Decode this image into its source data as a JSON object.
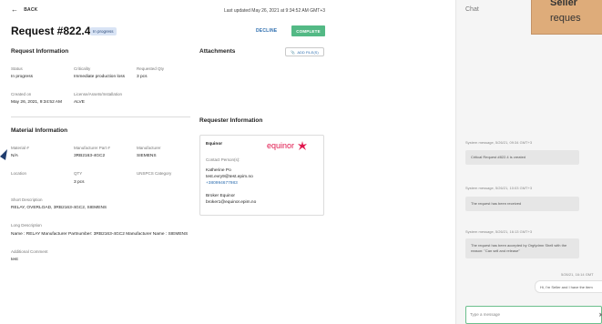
{
  "header": {
    "back_label": "BACK",
    "last_updated": "Last updated May 26, 2021 at 9:34:52 AM GMT+3",
    "title": "Request #822.4",
    "status": "In progress",
    "decline_label": "DECLINE",
    "complete_label": "COMPLETE"
  },
  "request_info": {
    "section_title": "Request Information",
    "status_label": "Status",
    "status_value": "In progress",
    "criticality_label": "Criticality",
    "criticality_value": "Immediate production loss",
    "requested_qty_label": "Requested Qty",
    "requested_qty_value": "3 pcs",
    "created_on_label": "Created on",
    "created_on_value": "May 26, 2021, 9:34:52 AM",
    "license_label": "License/Assets/Installation",
    "license_value": "ALVE"
  },
  "material_info": {
    "section_title": "Material Information",
    "material_no_label": "Material #",
    "material_no_value": "N/A",
    "mfr_part_label": "Manufacturer Part #",
    "mfr_part_value": "3RB2163-4GC2",
    "manufacturer_label": "Manufacturer",
    "manufacturer_value": "SIEMENS",
    "location_label": "Location",
    "qty_label": "QTY",
    "qty_value": "3 pcs",
    "unspsc_label": "UNSPCS Category",
    "short_desc_label": "Short Description",
    "short_desc_value": "RELAY, OVERLOAD, 3RB2163-4GC2, SIEMENS",
    "long_desc_label": "Long Description",
    "long_desc_value": "Name : RELAY Manufacturer Partnumber: 3RB2163-4GC2 Manufacturer Name : SIEMENS",
    "additional_comment_label": "Additional Comment",
    "additional_comment_value": "test"
  },
  "attachments": {
    "section_title": "Attachments",
    "add_files_label": "ADD FILE(S)"
  },
  "requester": {
    "section_title": "Requester Information",
    "company": "Equinor",
    "logo_text": "equinor",
    "contact_label": "Contact Person(s):",
    "contact_name": "Katherine Po",
    "contact_email": "test.evry9@test.epim.no",
    "contact_phone": "+380994677983",
    "broker_label": "Broker Equinor",
    "broker_email": "broker1@equinor.epim.no"
  },
  "chat": {
    "title": "Chat",
    "overlay_line1": "Seller",
    "overlay_line2": "reques",
    "messages": [
      {
        "time": "System message, 5/26/21, 09:34 GMT+3",
        "text": "Critical Request #822.4 is created"
      },
      {
        "time": "System message, 5/26/21, 10:03 GMT+3",
        "text": "The request has been received"
      },
      {
        "time": "System message, 5/26/21, 16:13 GMT+3",
        "text": "The request has been accepted by Orgfydmn Shell with the reason: \"Can sell and release\""
      }
    ],
    "user_time": "5/26/21, 16:14 GMT",
    "user_message": "Hi, I'm Seller and I have the item",
    "input_placeholder": "Type a message"
  },
  "colors": {
    "accent_green": "#53b985",
    "link_blue": "#2f6fb0",
    "equinor_red": "#e0174d",
    "overlay_tan": "#deac7a"
  }
}
